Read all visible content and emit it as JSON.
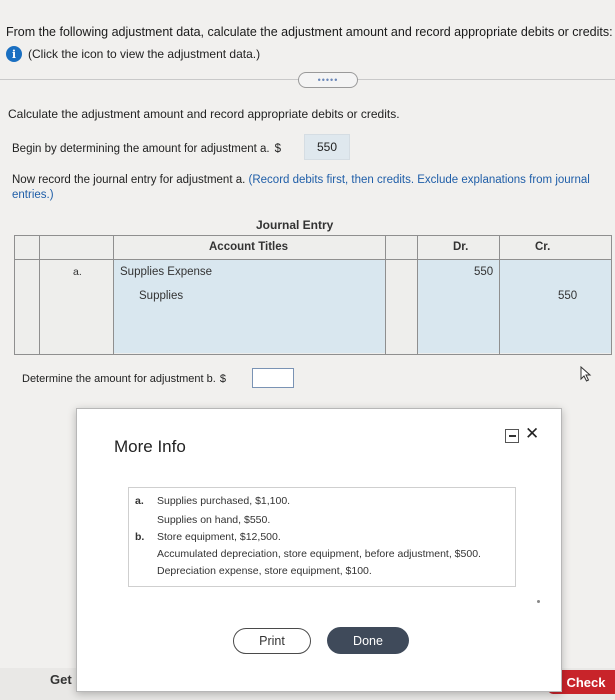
{
  "question": {
    "text": "From the following adjustment data, calculate the adjustment amount and record appropriate debits or credits:",
    "info_link": "(Click the icon to view the adjustment data.)"
  },
  "toggle_dots": "•••••",
  "section": {
    "heading": "Calculate the adjustment amount and record appropriate debits or credits.",
    "begin_text": "Begin by determining the amount for adjustment a.",
    "currency": "$",
    "amount_a": "550",
    "now_record_text": "Now record the journal entry for adjustment a.",
    "now_record_note": "(Record debits first, then credits. Exclude explanations from journal entries.)"
  },
  "journal": {
    "title": "Journal Entry",
    "headers": {
      "account": "Account Titles",
      "debit": "Dr.",
      "credit": "Cr."
    },
    "row_label": "a.",
    "rows": [
      {
        "account": "Supplies Expense",
        "debit": "550",
        "credit": ""
      },
      {
        "account": "Supplies",
        "debit": "",
        "credit": "550"
      }
    ]
  },
  "part_b": {
    "text": "Determine the amount for adjustment b.",
    "currency": "$",
    "value": ""
  },
  "modal": {
    "title": "More Info",
    "items": [
      {
        "letter": "a.",
        "lines": [
          "Supplies purchased, $1,100.",
          "Supplies on hand, $550."
        ]
      },
      {
        "letter": "b.",
        "lines": [
          "Store equipment, $12,500.",
          "Accumulated depreciation, store equipment, before adjustment, $500.",
          "Depreciation expense, store equipment, $100."
        ]
      }
    ],
    "print_label": "Print",
    "done_label": "Done"
  },
  "footer": {
    "get_more": "Get M",
    "check": "al Check"
  },
  "colors": {
    "accent": "#1a6fc1",
    "input_fill": "#d9e7ef",
    "check_red": "#c8242a",
    "done_dark": "#3f4a5a"
  }
}
